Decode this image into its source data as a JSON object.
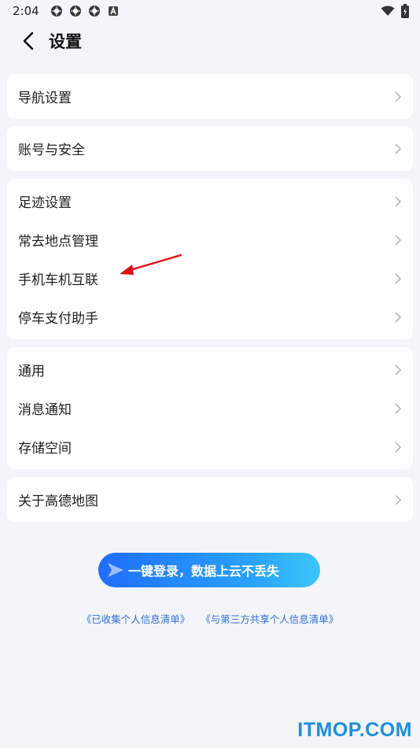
{
  "status_bar": {
    "time": "2:04",
    "icons": [
      "app-notification-icon",
      "app-notification-icon",
      "app-notification-icon",
      "a-notification-icon"
    ],
    "right_icons": [
      "wifi-icon",
      "battery-icon"
    ]
  },
  "header": {
    "title": "设置",
    "back_icon": "chevron-left-icon"
  },
  "sections": [
    {
      "items": [
        {
          "label": "导航设置"
        }
      ]
    },
    {
      "items": [
        {
          "label": "账号与安全"
        }
      ]
    },
    {
      "items": [
        {
          "label": "足迹设置"
        },
        {
          "label": "常去地点管理"
        },
        {
          "label": "手机车机互联"
        },
        {
          "label": "停车支付助手"
        }
      ]
    },
    {
      "items": [
        {
          "label": "通用"
        },
        {
          "label": "消息通知"
        },
        {
          "label": "存储空间"
        }
      ]
    },
    {
      "items": [
        {
          "label": "关于高德地图"
        }
      ]
    }
  ],
  "login": {
    "label": "一键登录，数据上云不丢失"
  },
  "links": {
    "collected": "《已收集个人信息清单》",
    "shared": "《与第三方共享个人信息清单》"
  },
  "watermark": "ITMOP.COM",
  "colors": {
    "background": "#f4f5f9",
    "accent": "#1f6dfb",
    "link": "#2f6fd8",
    "arrow": "#e01010",
    "watermark": "#1c8fe0"
  }
}
